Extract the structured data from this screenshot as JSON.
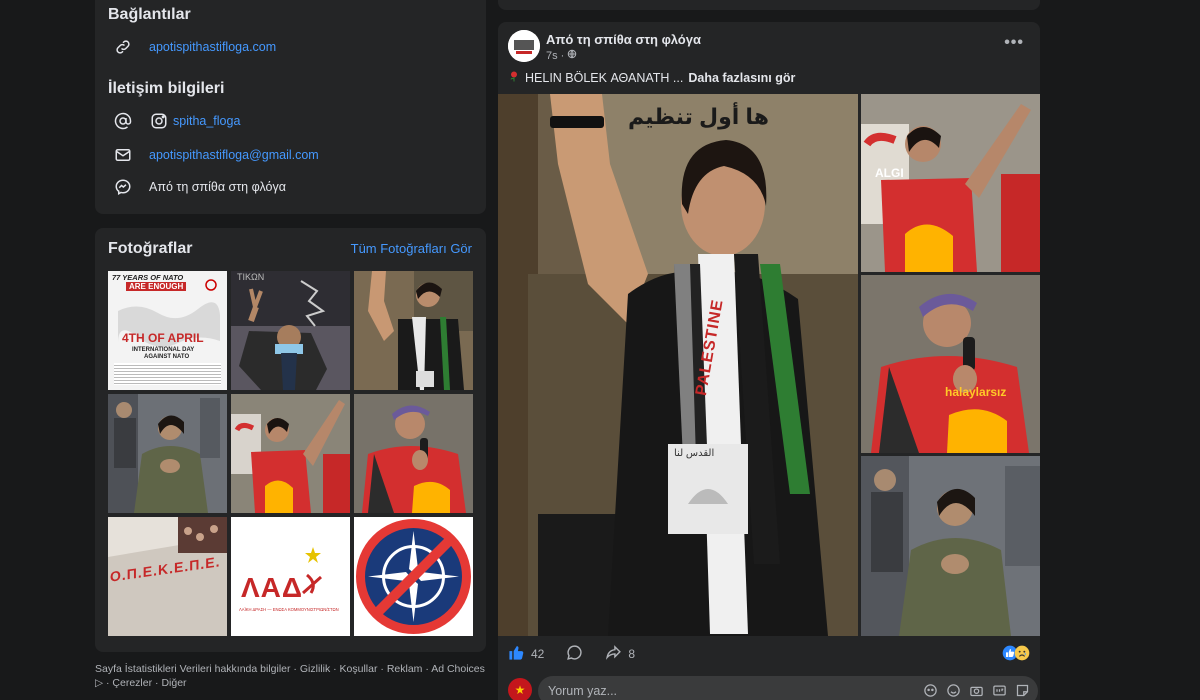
{
  "about": {
    "links_title": "Bağlantılar",
    "website": "apotispithastifloga.com",
    "contact_title": "İletişim bilgileri",
    "instagram": "spitha_floga",
    "email": "apotispithastifloga@gmail.com",
    "messenger": "Από τη σπίθα στη φλόγα"
  },
  "photos": {
    "title": "Fotoğraflar",
    "see_all": "Tüm Fotoğrafları Gör",
    "tile1": {
      "line1": "77 YEARS OF NATO",
      "line2": "ARE ENOUGH",
      "line3": "4TH OF APRIL",
      "line4": "INTERNATIONAL DAY",
      "line5": "AGAINST NATO"
    },
    "tile2_text": "ΤΙΚΩΝ",
    "tile7_text": "Ο.Π.Ε.Κ.Ε.Π.Ε.",
    "tile8": {
      "title": "ΛΑΔ",
      "subtitle": "ΛΑΪΚΗ ΔΡΑΣΗ — ΕΝΩΣΑ ΚΟΜΜΟΥΝΙΣΤΡΙΩΝ/ΣΤΩΝ"
    }
  },
  "footer": {
    "items": [
      "Sayfa İstatistikleri Verileri hakkında bilgiler",
      "Gizlilik",
      "Koşullar",
      "Reklam",
      "Ad Choices",
      "Çerezler",
      "Diğer"
    ]
  },
  "post": {
    "author": "Από τη σπίθα στη φλόγα",
    "time": "7s",
    "text": "HELIN BÖLEK ΑΘΑΝΑΤΗ ...",
    "see_more": "Daha fazlasını gör",
    "main_image": {
      "banner_text": "ها أول تنظيم",
      "scarf_text": "PALESTINE",
      "badge_text": "القدس لنا"
    },
    "side_image1": {
      "sign": "ALGI"
    },
    "side_image2": {
      "shirt": "halaylarsız"
    },
    "likes": "42",
    "shares": "8",
    "comment_placeholder": "Yorum yaz..."
  },
  "colors": {
    "background": "#18191a",
    "card": "#242526",
    "link": "#4599ff",
    "like_blue": "#2d88ff"
  }
}
